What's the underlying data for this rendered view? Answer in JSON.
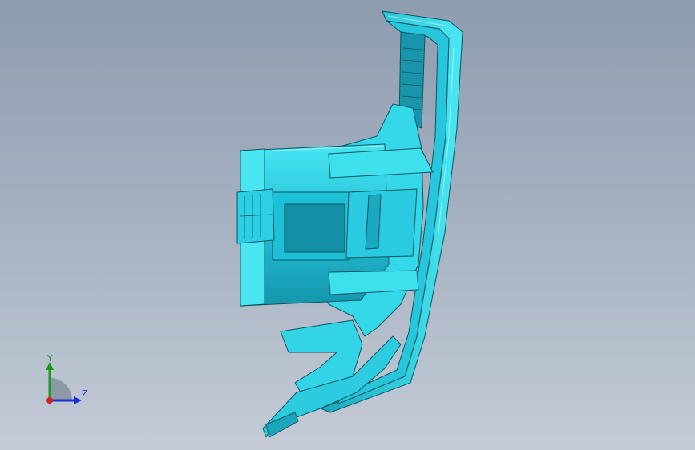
{
  "viewport": {
    "background_top": "#8e9cb0",
    "background_bottom": "#c3cbd6"
  },
  "model": {
    "part_color": "#33d6e6",
    "edge_color": "#0a5560",
    "shade_color": "#1a9fb4"
  },
  "triad": {
    "y_label": "Y",
    "z_label": "Z",
    "y_color": "#1d9b1d",
    "z_color": "#1a2fd0",
    "x_color": "#d42020"
  }
}
